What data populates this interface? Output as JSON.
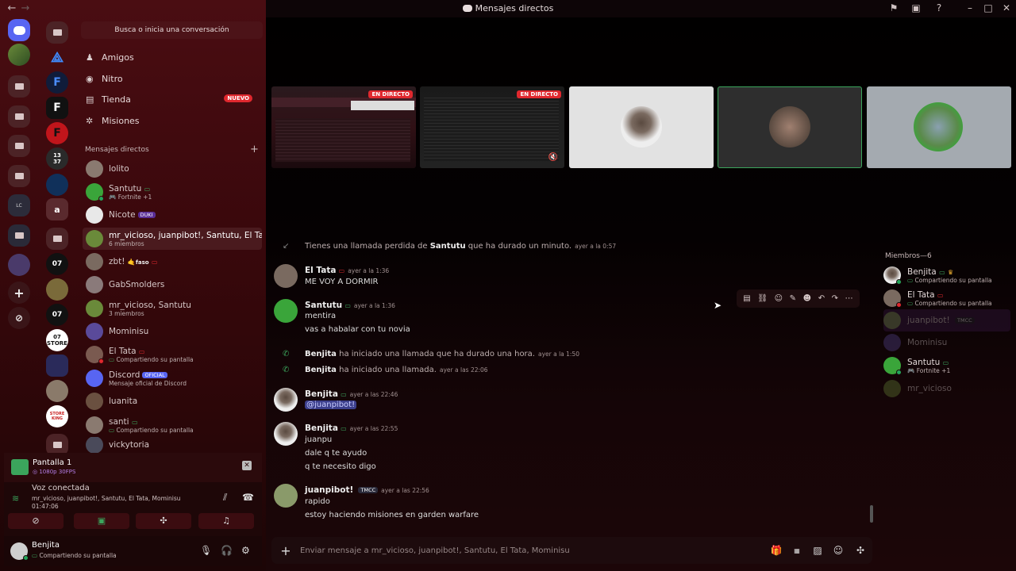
{
  "window": {
    "title": "Mensajes directos"
  },
  "search": {
    "label": "Busca o inicia una conversación"
  },
  "nav": [
    {
      "label": "Amigos"
    },
    {
      "label": "Nitro"
    },
    {
      "label": "Tienda",
      "badge": "NUEVO"
    },
    {
      "label": "Misiones"
    }
  ],
  "dm_header": "Mensajes directos",
  "dms": [
    {
      "name": "lolito",
      "sub": ""
    },
    {
      "name": "Santutu",
      "sub": "Fortnite +1"
    },
    {
      "name": "Nicote",
      "tag": "DUKI",
      "sub": ""
    },
    {
      "name": "mr_vicioso, juanpibot!, Santutu, El Tat...",
      "sub": "6 miembros"
    },
    {
      "name": "zbt!",
      "tag": "faso",
      "sub": ""
    },
    {
      "name": "GabSmolders",
      "sub": ""
    },
    {
      "name": "mr_vicioso, Santutu",
      "sub": "3 miembros"
    },
    {
      "name": "Mominisu",
      "sub": ""
    },
    {
      "name": "El Tata",
      "sub": "Compartiendo su pantalla"
    },
    {
      "name": "Discord",
      "tag": "OFICIAL",
      "sub": "Mensaje oficial de Discord"
    },
    {
      "name": "luanita",
      "sub": ""
    },
    {
      "name": "santi",
      "sub": "Compartiendo su pantalla"
    },
    {
      "name": "vickytoria",
      "sub": ""
    }
  ],
  "server_labels": {
    "f1": "F",
    "f2": "F",
    "f3": "F",
    "num": "13\n37",
    "a": "a",
    "s07a": "07",
    "s07b": "07",
    "s07c": "07\nSTORE",
    "store": "STORE\nKING",
    "lc": "LC"
  },
  "stream": {
    "title": "Pantalla 1",
    "quality": "1080p 30FPS"
  },
  "voice": {
    "status": "Voz conectada",
    "members": "mr_vicioso, juanpibot!, Santutu, El Tata, Mominisu",
    "timer": "01:47:06"
  },
  "user": {
    "name": "Benjita",
    "status": "Compartiendo su pantalla"
  },
  "tiles": [
    {
      "live": "EN DIRECTO"
    },
    {
      "live": "EN DIRECTO"
    }
  ],
  "chat": {
    "missed": {
      "text": "Tienes una llamada perdida de",
      "who": "Santutu",
      "rest": "que ha durado un minuto.",
      "time": "ayer a la 0:57"
    },
    "m1": {
      "name": "El Tata",
      "time": "ayer a la 1:36",
      "lines": [
        "ME VOY A DORMIR"
      ]
    },
    "m2": {
      "name": "Santutu",
      "time": "ayer a la 1:36",
      "lines": [
        "mentira",
        "vas a habalar con tu novia"
      ]
    },
    "call1": {
      "who": "Benjita",
      "text": "ha iniciado una llamada que ha durado una hora.",
      "time": "ayer a la 1:50"
    },
    "call2": {
      "who": "Benjita",
      "text": "ha iniciado una llamada.",
      "time": "ayer a las 22:06"
    },
    "m3": {
      "name": "Benjita",
      "time": "ayer a las 22:46",
      "lines": [
        "@juanpibot!"
      ]
    },
    "m4": {
      "name": "Benjita",
      "time": "ayer a las 22:55",
      "lines": [
        "juanpu",
        "dale q te ayudo",
        "q te necesito digo"
      ]
    },
    "m5": {
      "name": "juanpibot!",
      "tag": "TMCC",
      "time": "ayer a las 22:56",
      "lines": [
        "rapido",
        "estoy haciendo misiones en garden warfare"
      ]
    }
  },
  "input": {
    "placeholder": "Enviar mensaje a mr_vicioso, juanpibot!, Santutu, El Tata, Mominisu"
  },
  "members": {
    "header": "Miembros—6",
    "list": [
      {
        "name": "Benjita",
        "sub": "Compartiendo su pantalla"
      },
      {
        "name": "El Tata",
        "sub": "Compartiendo su pantalla"
      },
      {
        "name": "juanpibot!",
        "tag": "TMCC",
        "sub": ""
      },
      {
        "name": "Mominisu",
        "sub": ""
      },
      {
        "name": "Santutu",
        "sub": "Fortnite +1"
      },
      {
        "name": "mr_vicioso",
        "sub": ""
      }
    ]
  },
  "colors": {
    "accent": "#e0282e",
    "online": "#23a55a",
    "mention": "#3c3f8c",
    "live": "#e0282e"
  }
}
